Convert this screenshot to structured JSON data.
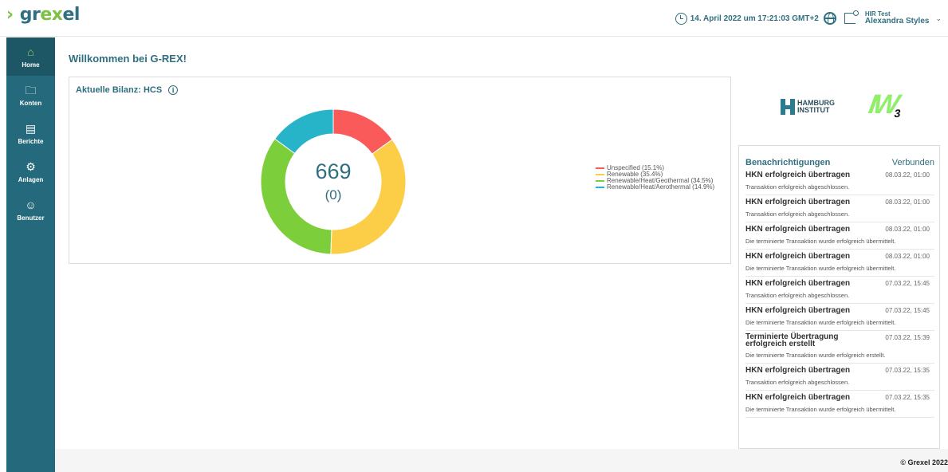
{
  "header": {
    "logo": {
      "prefix": "› ",
      "part1": "gr",
      "part2": "ex",
      "part3": "el"
    },
    "datetime": "14. April 2022 um 17:21:03 GMT+2",
    "user_org": "HIR Test",
    "user_name": "Alexandra Styles",
    "icons": [
      "clock-icon",
      "globe-icon",
      "logout-icon",
      "chevron-down-icon"
    ]
  },
  "sidebar": {
    "items": [
      {
        "label": "Home",
        "icon": "home-icon",
        "active": true
      },
      {
        "label": "Konten",
        "icon": "folder-icon",
        "active": false
      },
      {
        "label": "Berichte",
        "icon": "document-icon",
        "active": false
      },
      {
        "label": "Anlagen",
        "icon": "gears-icon",
        "active": false
      },
      {
        "label": "Benutzer",
        "icon": "user-icon",
        "active": false
      }
    ]
  },
  "main": {
    "welcome": "Willkommen bei G-REX!",
    "balance_title": "Aktuelle Bilanz: HCS",
    "center_value": "669",
    "center_sub": "(0)"
  },
  "chart_data": {
    "type": "pie",
    "donut": true,
    "categories": [
      "Unspecified",
      "Renewable",
      "Renewable/Heat/Geothermal",
      "Renewable/Heat/Aerothermal"
    ],
    "legend_labels": [
      "Unspecified (15.1%)",
      "Renewable (35.4%)",
      "Renewable/Heat/Geothermal (34.5%)",
      "Renewable/Heat/Aerothermal (14.9%)"
    ],
    "values": [
      15.1,
      35.4,
      34.5,
      14.9
    ],
    "colors": [
      "#fa5a5a",
      "#fccd46",
      "#7ccf3a",
      "#28b4c8"
    ],
    "legend_position": "right"
  },
  "partners": {
    "hamburg": [
      "HAMBURG",
      "INSTITUT"
    ],
    "iw3": {
      "main": "IW",
      "sub": "3"
    }
  },
  "notifications": {
    "title": "Benachrichtigungen",
    "status": "Verbunden",
    "items": [
      {
        "title": "HKN erfolgreich übertragen",
        "date": "08.03.22, 01:00",
        "message": "Transaktion erfolgreich abgeschlossen."
      },
      {
        "title": "HKN erfolgreich übertragen",
        "date": "08.03.22, 01:00",
        "message": "Transaktion erfolgreich abgeschlossen."
      },
      {
        "title": "HKN erfolgreich übertragen",
        "date": "08.03.22, 01:00",
        "message": "Die terminierte Transaktion wurde erfolgreich übermittelt."
      },
      {
        "title": "HKN erfolgreich übertragen",
        "date": "08.03.22, 01:00",
        "message": "Die terminierte Transaktion wurde erfolgreich übermittelt."
      },
      {
        "title": "HKN erfolgreich übertragen",
        "date": "07.03.22, 15:45",
        "message": "Transaktion erfolgreich abgeschlossen."
      },
      {
        "title": "HKN erfolgreich übertragen",
        "date": "07.03.22, 15:45",
        "message": "Die terminierte Transaktion wurde erfolgreich übermittelt."
      },
      {
        "title": "Terminierte Übertragung erfolgreich erstellt",
        "date": "07.03.22, 15:39",
        "message": "Die terminierte Transaktion wurde erfolgreich erstellt."
      },
      {
        "title": "HKN erfolgreich übertragen",
        "date": "07.03.22, 15:35",
        "message": "Transaktion erfolgreich abgeschlossen."
      },
      {
        "title": "HKN erfolgreich übertragen",
        "date": "07.03.22, 15:35",
        "message": "Die terminierte Transaktion wurde erfolgreich übermittelt."
      }
    ]
  },
  "footer": {
    "copyright": "© Grexel 2022"
  }
}
